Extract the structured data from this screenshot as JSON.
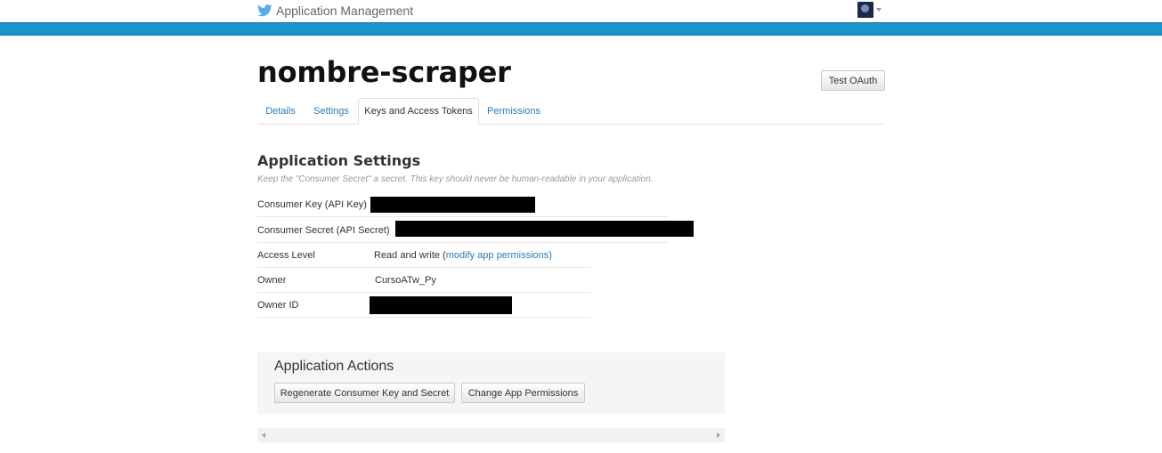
{
  "navbar": {
    "brand_text": "Application Management",
    "brand_icon": "twitter-bird-icon",
    "brand_color": "#55acee",
    "stripe_color": "#1b95c9"
  },
  "header": {
    "app_title": "nombre-scraper",
    "test_oauth_label": "Test OAuth"
  },
  "tabs": [
    {
      "label": "Details",
      "active": false
    },
    {
      "label": "Settings",
      "active": false
    },
    {
      "label": "Keys and Access Tokens",
      "active": true
    },
    {
      "label": "Permissions",
      "active": false
    }
  ],
  "settings": {
    "heading": "Application Settings",
    "hint": "Keep the \"Consumer Secret\" a secret. This key should never be human-readable in your application.",
    "rows": {
      "consumer_key": {
        "label": "Consumer Key (API Key)",
        "redacted": true
      },
      "consumer_secret": {
        "label": "Consumer Secret (API Secret)",
        "redacted": true
      },
      "access_level": {
        "label": "Access Level",
        "value": "Read and write",
        "link_text": "modify app permissions"
      },
      "owner": {
        "label": "Owner",
        "value": "CursoATw_Py"
      },
      "owner_id": {
        "label": "Owner ID",
        "redacted": true
      }
    }
  },
  "actions": {
    "heading": "Application Actions",
    "regenerate_label": "Regenerate Consumer Key and Secret",
    "change_permissions_label": "Change App Permissions"
  }
}
